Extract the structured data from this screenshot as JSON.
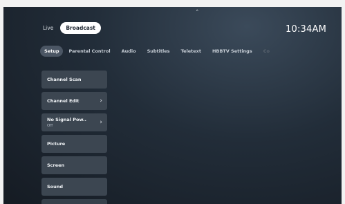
{
  "top": {
    "up_icon": "chevron-up-icon",
    "up_glyph": "˄"
  },
  "source_tabs": [
    {
      "label": "Live",
      "active": false
    },
    {
      "label": "Broadcast",
      "active": true
    }
  ],
  "clock": "10:34AM",
  "menu_tabs": [
    {
      "label": "Setup",
      "active": true
    },
    {
      "label": "Parental Control"
    },
    {
      "label": "Audio"
    },
    {
      "label": "Subtitles"
    },
    {
      "label": "Teletext"
    },
    {
      "label": "HBBTV Settings"
    },
    {
      "label": "Co",
      "faded": true
    }
  ],
  "setup_items": [
    {
      "label": "Channel Scan",
      "sub": "",
      "chevron": false
    },
    {
      "label": "Channel Edit",
      "sub": "",
      "chevron": true
    },
    {
      "label": "No Signal Pow..",
      "sub": "Off",
      "chevron": true
    },
    {
      "label": "Picture",
      "sub": "",
      "chevron": false
    },
    {
      "label": "Screen",
      "sub": "",
      "chevron": false
    },
    {
      "label": "Sound",
      "sub": "",
      "chevron": false
    }
  ],
  "chevron_glyph": "›"
}
